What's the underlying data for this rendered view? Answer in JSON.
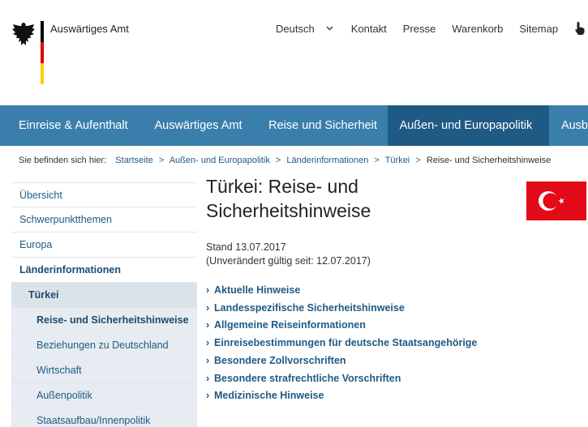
{
  "header": {
    "logo_text": "Auswärtiges Amt",
    "topnav": {
      "language": "Deutsch",
      "items": [
        "Kontakt",
        "Presse",
        "Warenkorb",
        "Sitemap"
      ]
    }
  },
  "mainnav": {
    "items": [
      "Einreise & Aufenthalt",
      "Auswärtiges Amt",
      "Reise und Sicherheit",
      "Außen- und Europapolitik",
      "Ausb"
    ]
  },
  "breadcrumb": {
    "prefix": "Sie befinden sich hier:",
    "items": [
      "Startseite",
      "Außen- und Europapolitik",
      "Länderinformationen",
      "Türkei",
      "Reise- und Sicherheitshinweise"
    ]
  },
  "sidebar": {
    "items": [
      "Übersicht",
      "Schwerpunktthemen",
      "Europa",
      "Länderinformationen",
      "Türkei",
      "Reise- und Sicherheitshinweise",
      "Beziehungen zu Deutschland",
      "Wirtschaft",
      "Außenpolitik",
      "Staatsaufbau/Innenpolitik"
    ]
  },
  "content": {
    "title_line1": "Türkei: Reise- und",
    "title_line2": "Sicherheitshinweise",
    "stand": "Stand 13.07.2017",
    "unchanged": "(Unverändert gültig seit: 12.07.2017)",
    "links": [
      "Aktuelle Hinweise",
      "Landesspezifische Sicherheitshinweise",
      "Allgemeine Reiseinformationen",
      "Einreisebestimmungen für deutsche Staatsangehörige",
      "Besondere Zollvorschriften",
      "Besondere strafrechtliche Vorschriften",
      "Medizinische Hinweise"
    ]
  },
  "colors": {
    "nav_bg": "#3a7fab",
    "nav_active": "#1f5a85",
    "link": "#1f5a85",
    "flag_red": "#e30a17"
  },
  "icons": {
    "eagle": "federal-eagle-icon",
    "chevron": "chevron-down-icon",
    "hand": "hand-pointer-icon",
    "link_arrow": "chevron-right-icon",
    "flag": "turkey-flag-icon"
  }
}
